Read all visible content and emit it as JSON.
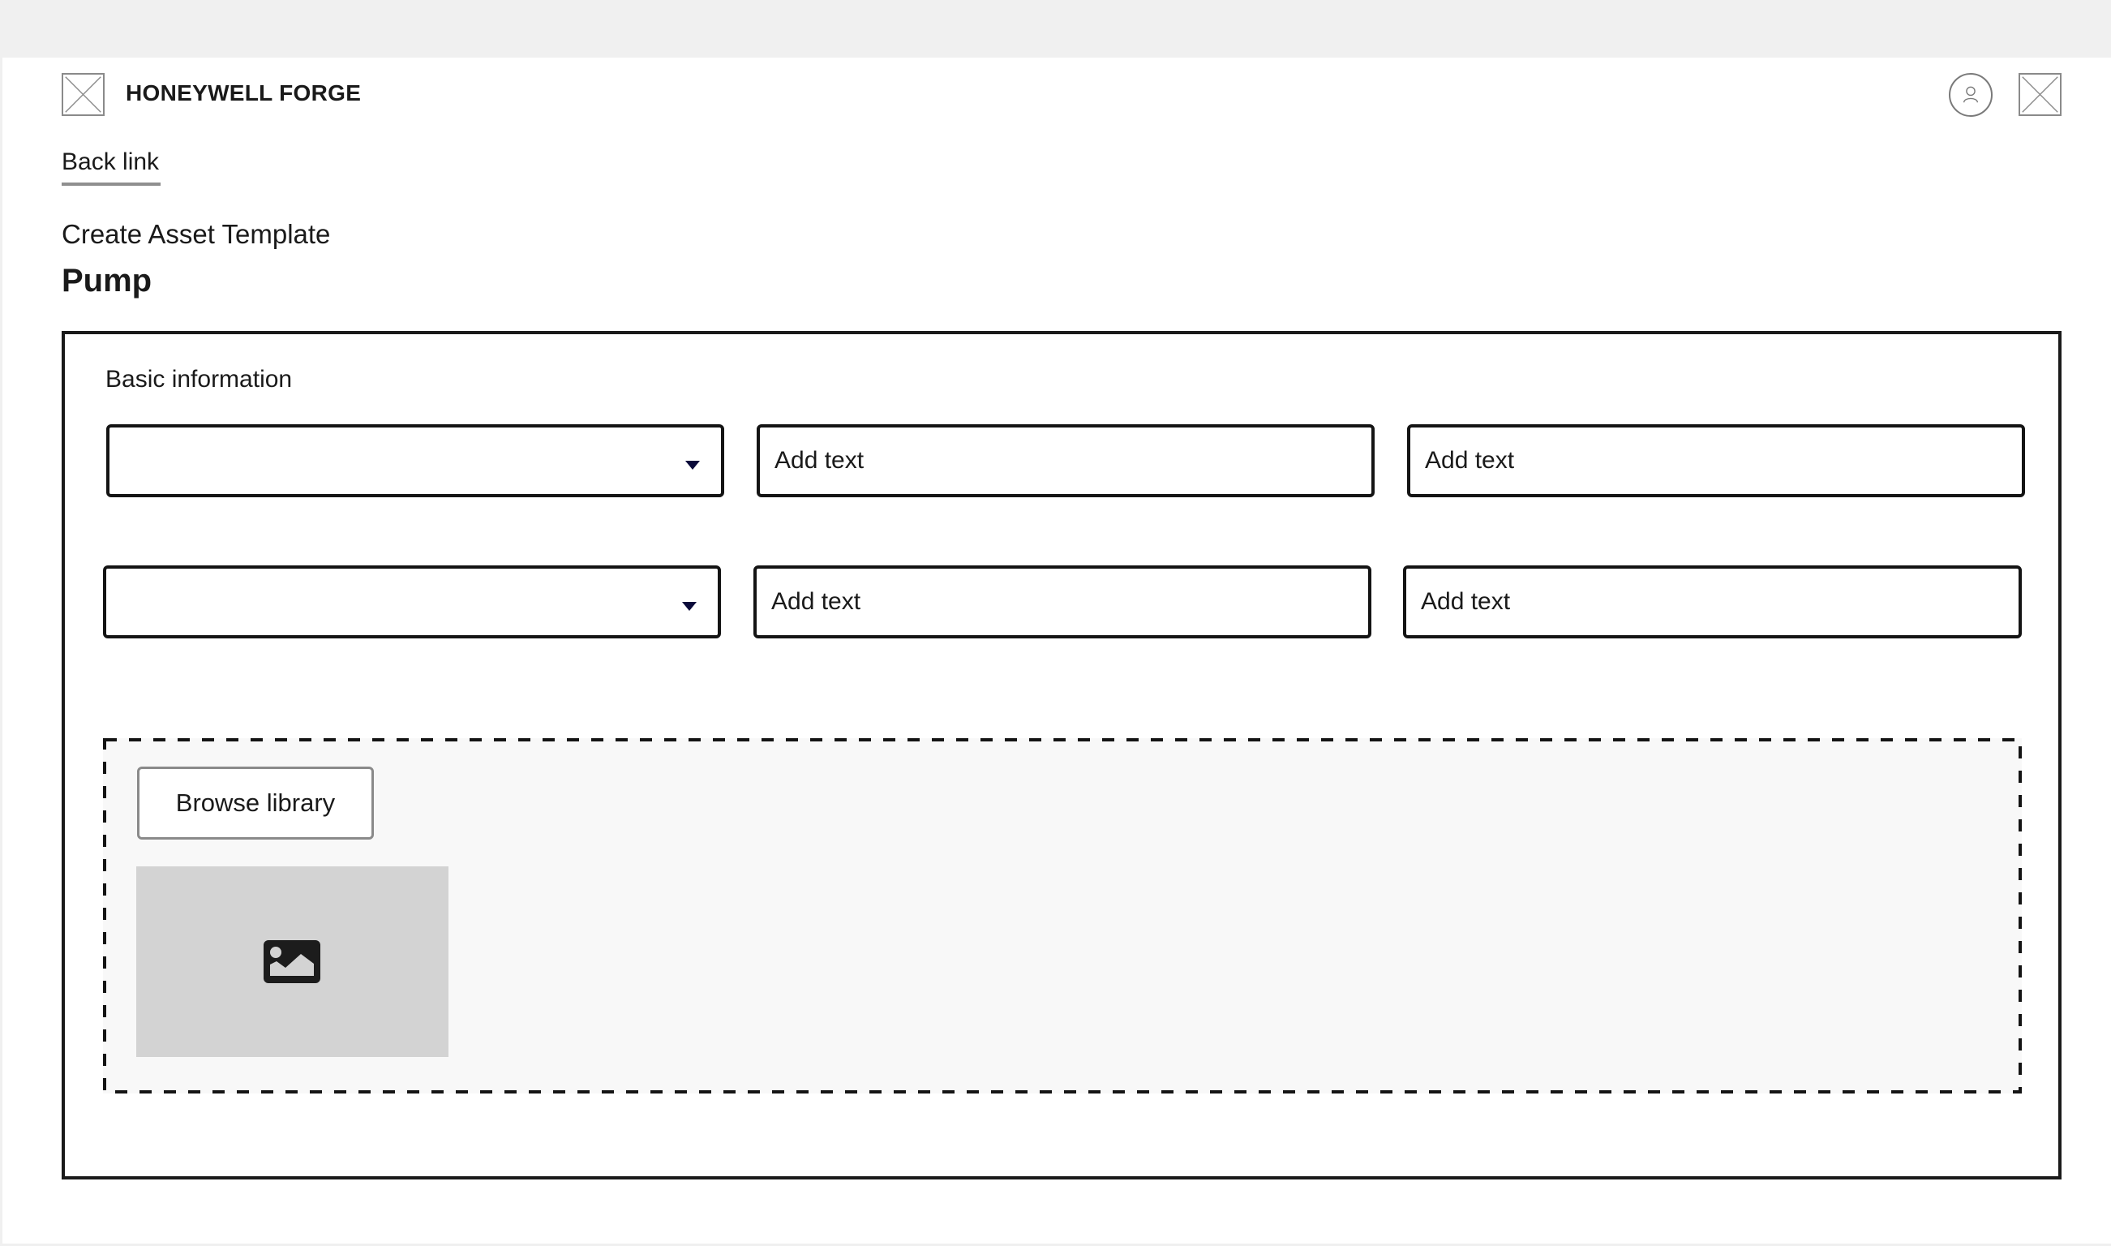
{
  "header": {
    "brand": "HONEYWELL FORGE",
    "logo_icon": "image-placeholder-icon",
    "user_icon": "user-avatar-icon",
    "app_icon": "image-placeholder-icon"
  },
  "nav": {
    "back_link": "Back link"
  },
  "page": {
    "subtitle": "Create Asset Template",
    "title": "Pump"
  },
  "basic_information": {
    "label": "Basic information",
    "rows": [
      {
        "select": {
          "value": "",
          "icon": "caret-down-icon"
        },
        "inputs": [
          {
            "value": "",
            "placeholder": "Add text"
          },
          {
            "value": "",
            "placeholder": "Add text"
          }
        ]
      },
      {
        "select": {
          "value": "",
          "icon": "caret-down-icon"
        },
        "inputs": [
          {
            "value": "",
            "placeholder": "Add text"
          },
          {
            "value": "",
            "placeholder": "Add text"
          }
        ]
      }
    ]
  },
  "media": {
    "browse_label": "Browse library",
    "image_icon": "image-icon"
  },
  "colors": {
    "topbar": "#f0f0f0",
    "border": "#141414",
    "caret": "#0a0a3a",
    "dropzone_bg": "#f8f8f8",
    "image_placeholder_bg": "#d3d3d3",
    "secondary_border": "#8a8a8a"
  }
}
